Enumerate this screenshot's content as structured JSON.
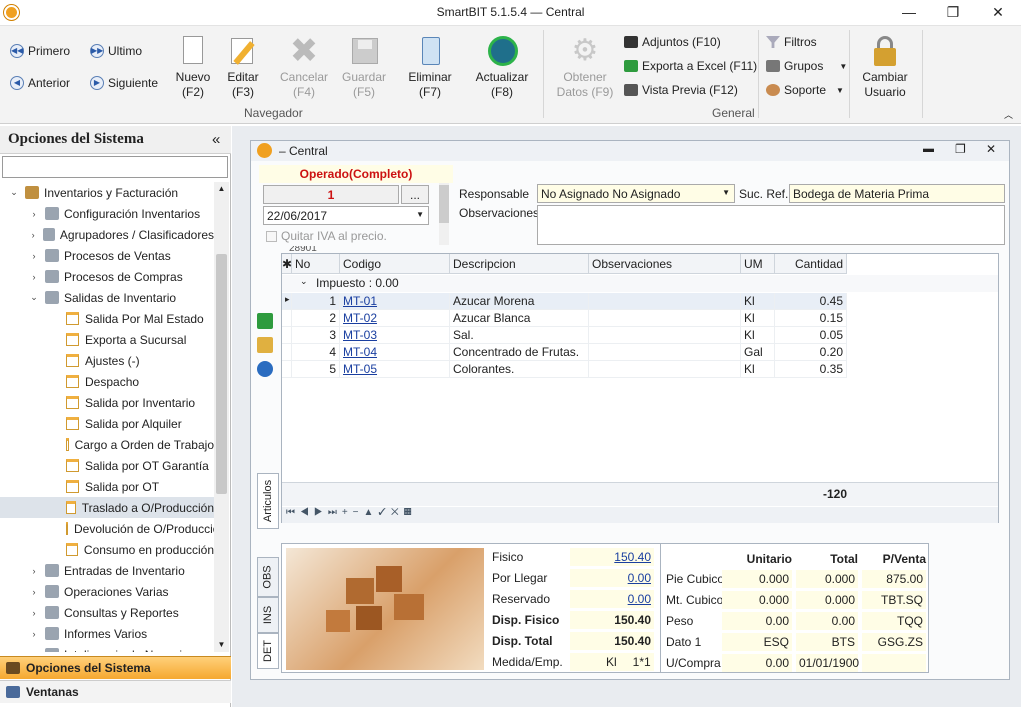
{
  "window": {
    "title": "SmartBIT 5.1.5.4 — Central",
    "minimize": "—",
    "maximize": "❐",
    "close": "✕"
  },
  "ribbon": {
    "nav": {
      "first": "Primero",
      "last": "Ultimo",
      "prev": "Anterior",
      "next": "Siguiente"
    },
    "buttons": [
      {
        "line1": "Nuevo",
        "line2": "(F2)"
      },
      {
        "line1": "Editar",
        "line2": "(F3)"
      },
      {
        "line1": "Cancelar",
        "line2": "(F4)"
      },
      {
        "line1": "Guardar",
        "line2": "(F5)"
      },
      {
        "line1": "Eliminar",
        "line2": "(F7)"
      },
      {
        "line1": "Actualizar",
        "line2": "(F8)"
      },
      {
        "line1": "Obtener",
        "line2": "Datos (F9)"
      },
      {
        "line1": "Cambiar",
        "line2": "Usuario"
      }
    ],
    "small": {
      "adjuntos": "Adjuntos (F10)",
      "excel": "Exporta a Excel (F11)",
      "preview": "Vista Previa (F12)",
      "filtros": "Filtros",
      "grupos": "Grupos",
      "soporte": "Soporte"
    },
    "groups": {
      "navegador": "Navegador",
      "general": "General"
    }
  },
  "sidebar": {
    "title": "Opciones del Sistema",
    "collapse": "«",
    "items": [
      {
        "label": "Inventarios y Facturación",
        "level": 0,
        "arrow": "⌄"
      },
      {
        "label": "Configuración Inventarios",
        "level": 1,
        "arrow": "›"
      },
      {
        "label": "Agrupadores / Clasificadores",
        "level": 1,
        "arrow": "›"
      },
      {
        "label": "Procesos de Ventas",
        "level": 1,
        "arrow": "›"
      },
      {
        "label": "Procesos de Compras",
        "level": 1,
        "arrow": "›"
      },
      {
        "label": "Salidas de Inventario",
        "level": 1,
        "arrow": "⌄"
      },
      {
        "label": "Salida Por Mal Estado",
        "level": 2
      },
      {
        "label": "Exporta a Sucursal",
        "level": 2
      },
      {
        "label": "Ajustes (-)",
        "level": 2
      },
      {
        "label": "Despacho",
        "level": 2
      },
      {
        "label": "Salida por Inventario",
        "level": 2
      },
      {
        "label": "Salida por Alquiler",
        "level": 2
      },
      {
        "label": "Cargo a Orden de Trabajo",
        "level": 2
      },
      {
        "label": "Salida por OT Garantía",
        "level": 2
      },
      {
        "label": "Salida por OT",
        "level": 2
      },
      {
        "label": "Traslado a O/Producción",
        "level": 2,
        "selected": true
      },
      {
        "label": "Devolución de O/Producció",
        "level": 2
      },
      {
        "label": "Consumo en producción",
        "level": 2
      },
      {
        "label": "Entradas de Inventario",
        "level": 1,
        "arrow": "›"
      },
      {
        "label": "Operaciones Varias",
        "level": 1,
        "arrow": "›"
      },
      {
        "label": "Consultas y Reportes",
        "level": 1,
        "arrow": "›"
      },
      {
        "label": "Informes Varios",
        "level": 1,
        "arrow": "›"
      },
      {
        "label": "Inteligencia de Negocios",
        "level": 1,
        "arrow": "›"
      }
    ],
    "tab_options": "Opciones del Sistema",
    "tab_windows": "Ventanas"
  },
  "doc": {
    "title": "– Central",
    "status": "Operado(Completo)",
    "number": "1",
    "date": "22/06/2017",
    "iva": "Quitar IVA al precio.",
    "clipped": "28901",
    "responsable_label": "Responsable",
    "responsable": "No Asignado No Asignado",
    "sucref_label": "Suc. Ref.",
    "sucref": "Bodega de Materia Prima",
    "obs_label": "Observaciones",
    "dots": "..."
  },
  "grid": {
    "headers": [
      "✱",
      "No",
      "Codigo",
      "Descripcion",
      "Observaciones",
      "UM",
      "Cantidad"
    ],
    "group": "Impuesto : 0.00",
    "rows": [
      {
        "no": "1",
        "code": "MT-01",
        "desc": "Azucar Morena",
        "obs": "",
        "um": "Kl",
        "qty": "0.45"
      },
      {
        "no": "2",
        "code": "MT-02",
        "desc": "Azucar Blanca",
        "obs": "",
        "um": "Kl",
        "qty": "0.15"
      },
      {
        "no": "3",
        "code": "MT-03",
        "desc": "Sal.",
        "obs": "",
        "um": "Kl",
        "qty": "0.05"
      },
      {
        "no": "4",
        "code": "MT-04",
        "desc": "Concentrado de Frutas.",
        "obs": "",
        "um": "Gal",
        "qty": "0.20"
      },
      {
        "no": "5",
        "code": "MT-05",
        "desc": "Colorantes.",
        "obs": "",
        "um": "Kl",
        "qty": "0.35"
      }
    ],
    "total": "-120"
  },
  "tabs": {
    "articulos": "Articulos",
    "obs": "OBS",
    "ins": "INS",
    "det": "DET"
  },
  "stock": [
    {
      "label": "Fisico",
      "value": "150.40",
      "link": true
    },
    {
      "label": "Por Llegar",
      "value": "0.00",
      "link": true
    },
    {
      "label": "Reservado",
      "value": "0.00",
      "link": true
    },
    {
      "label": "Disp. Fisico",
      "value": "150.40",
      "bold": true
    },
    {
      "label": "Disp. Total",
      "value": "150.40",
      "bold": true
    },
    {
      "label": "Medida/Emp.",
      "value": "Kl",
      "extra": "1*1"
    }
  ],
  "measures": {
    "headers": [
      "Unitario",
      "Total",
      "P/Venta"
    ],
    "rows": [
      {
        "label": "Pie Cubico",
        "a": "0.000",
        "b": "0.000",
        "c": "875.00"
      },
      {
        "label": "Mt. Cubico",
        "a": "0.000",
        "b": "0.000",
        "c": "TBT.SQ"
      },
      {
        "label": "Peso",
        "a": "0.00",
        "b": "0.00",
        "c": "TQQ"
      },
      {
        "label": "Dato 1",
        "a": "ESQ",
        "b": "BTS",
        "c": "GSG.ZS"
      },
      {
        "label": "U/Compra",
        "a": "0.00",
        "b": "01/01/1900",
        "c": ""
      }
    ]
  }
}
